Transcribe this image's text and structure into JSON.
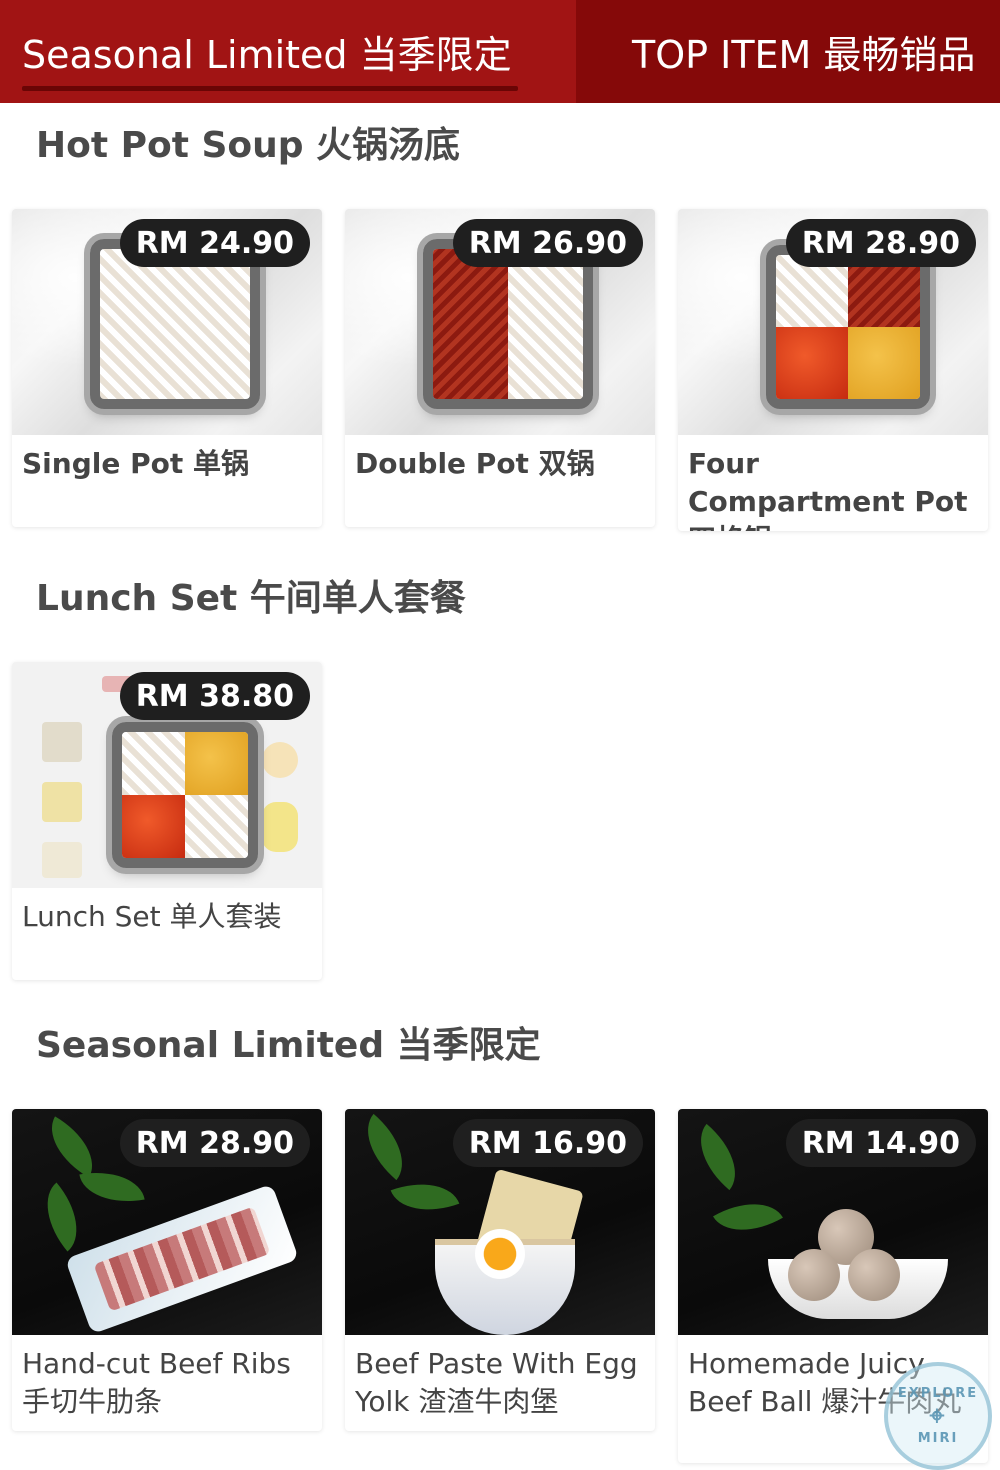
{
  "tabs": [
    {
      "label": "Seasonal Limited 当季限定",
      "active": true
    },
    {
      "label": "TOP ITEM 最畅销品",
      "active": false
    }
  ],
  "sections": {
    "hotpot": {
      "title": "Hot Pot Soup 火锅汤底",
      "items": [
        {
          "name": "Single Pot 单锅",
          "price": "RM 24.90"
        },
        {
          "name": "Double Pot 双锅",
          "price": "RM 26.90"
        },
        {
          "name": "Four Compartment Pot 四格锅",
          "price": "RM 28.90"
        }
      ]
    },
    "lunch": {
      "title": "Lunch Set 午间单人套餐",
      "items": [
        {
          "name": "Lunch Set 单人套装",
          "price": "RM 38.80"
        }
      ]
    },
    "seasonal": {
      "title": "Seasonal Limited 当季限定",
      "items": [
        {
          "name": "Hand-cut Beef Ribs 手切牛肋条",
          "price": "RM 28.90"
        },
        {
          "name": "Beef Paste With Egg Yolk 渣渣牛肉堡",
          "price": "RM 16.90"
        },
        {
          "name": "Homemade Juicy Beef Ball 爆汁牛肉丸",
          "price": "RM 14.90"
        }
      ]
    }
  },
  "watermark": {
    "top": "EXPLORE",
    "bottom": "MIRI"
  },
  "colors": {
    "tab_bar": "#8d0a0a",
    "active_tab": "#a11414",
    "price_badge": "#1f1f1f"
  }
}
